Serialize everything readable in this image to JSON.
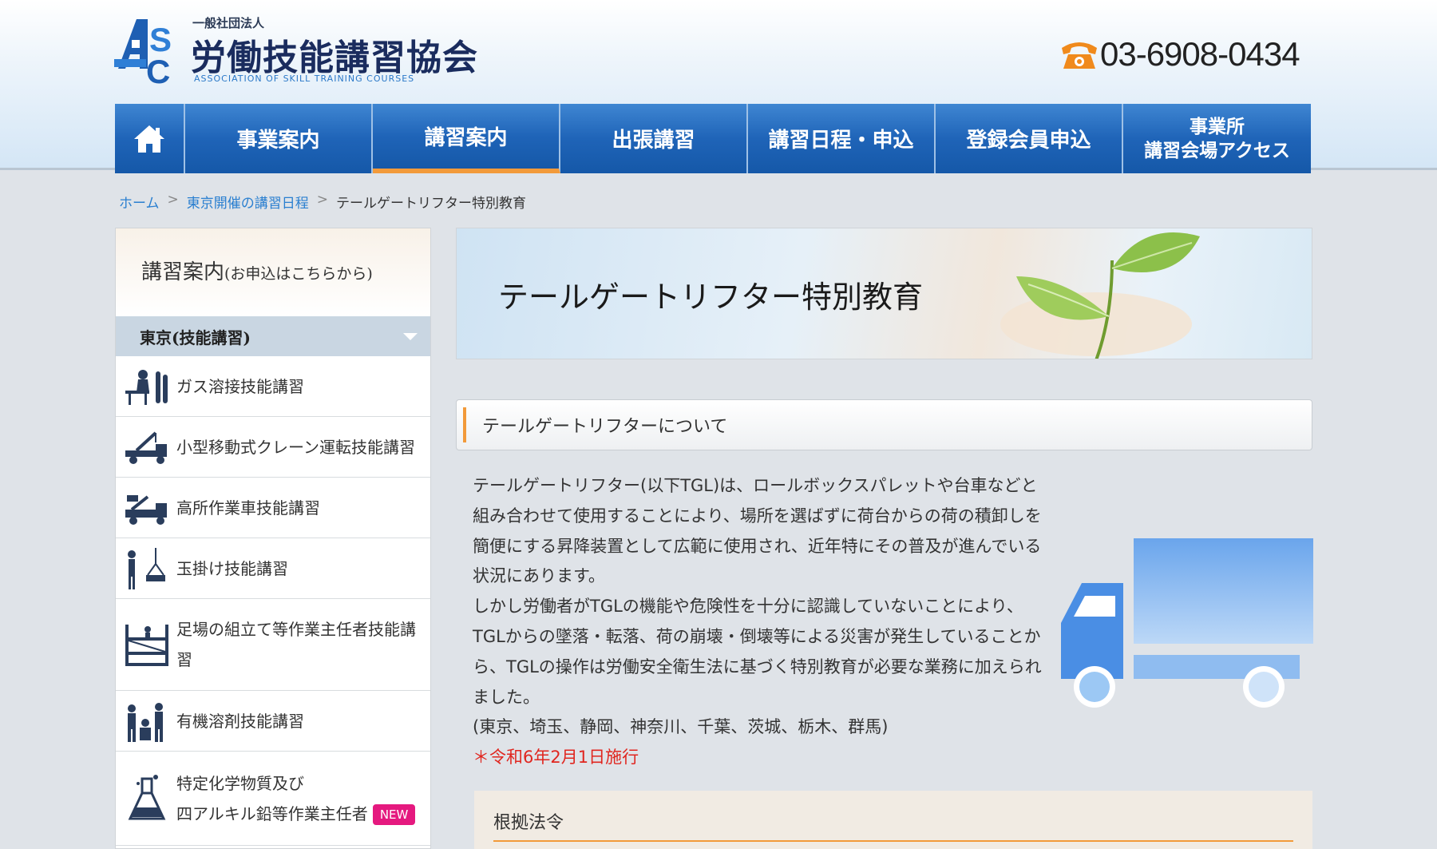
{
  "header": {
    "logo_small": "一般社団法人",
    "logo_name": "労働技能講習協会",
    "logo_en": "ASSOCIATION OF SKILL TRAINING COURSES",
    "logo_mark": "ASC",
    "phone": "03-6908-0434"
  },
  "nav": {
    "home_icon": "home-icon",
    "items": [
      {
        "label": "事業案内"
      },
      {
        "label": "講習案内",
        "active": true
      },
      {
        "label": "出張講習"
      },
      {
        "label": "講習日程・申込"
      },
      {
        "label": "登録会員申込"
      },
      {
        "label_line1": "事業所",
        "label_line2": "講習会場アクセス"
      }
    ]
  },
  "breadcrumb": {
    "home": "ホーム",
    "sep": ">",
    "parent": "東京開催の講習日程",
    "current": "テールゲートリフター特別教育"
  },
  "sidebar": {
    "title": "講習案内",
    "title_note": "(お申込はこちらから)",
    "category": "東京(技能講習)",
    "items": [
      {
        "label": "ガス溶接技能講習",
        "icon": "welder-icon"
      },
      {
        "label": "小型移動式クレーン運転技能講習",
        "icon": "crane-truck-icon"
      },
      {
        "label": "高所作業車技能講習",
        "icon": "aerial-work-truck-icon"
      },
      {
        "label": "玉掛け技能講習",
        "icon": "slinging-icon"
      },
      {
        "label": "足場の組立て等作業主任者技能講習",
        "icon": "scaffold-icon"
      },
      {
        "label": "有機溶剤技能講習",
        "icon": "organic-solvent-icon"
      },
      {
        "label_line1": "特定化学物質及び",
        "label_line2": "四アルキル鉛等作業主任者",
        "badge": "NEW",
        "icon": "flask-icon"
      }
    ]
  },
  "banner": {
    "title": "テールゲートリフター特別教育"
  },
  "section": {
    "heading": "テールゲートリフターについて",
    "paragraphs": [
      "テールゲートリフター(以下TGL)は、ロールボックスパレットや台車などと組み合わせて使用することにより、場所を選ばずに荷台からの荷の積卸しを簡便にする昇降装置として広範に使用され、近年特にその普及が進んでいる状況にあります。",
      "しかし労働者がTGLの機能や危険性を十分に認識していないことにより、TGLからの墜落・転落、荷の崩壊・倒壊等による災害が発生していることから、TGLの操作は労働安全衛生法に基づく特別教育が必要な業務に加えられました。",
      "(東京、埼玉、静岡、神奈川、千葉、茨城、栃木、群馬)"
    ],
    "note": "＊令和6年2月1日施行"
  },
  "law": {
    "heading": "根拠法令"
  },
  "colors": {
    "nav_blue": "#1f64b8",
    "accent_orange": "#f29a3a",
    "link_blue": "#2a7fd0",
    "note_red": "#e0261f",
    "badge_pink": "#e5197f"
  }
}
